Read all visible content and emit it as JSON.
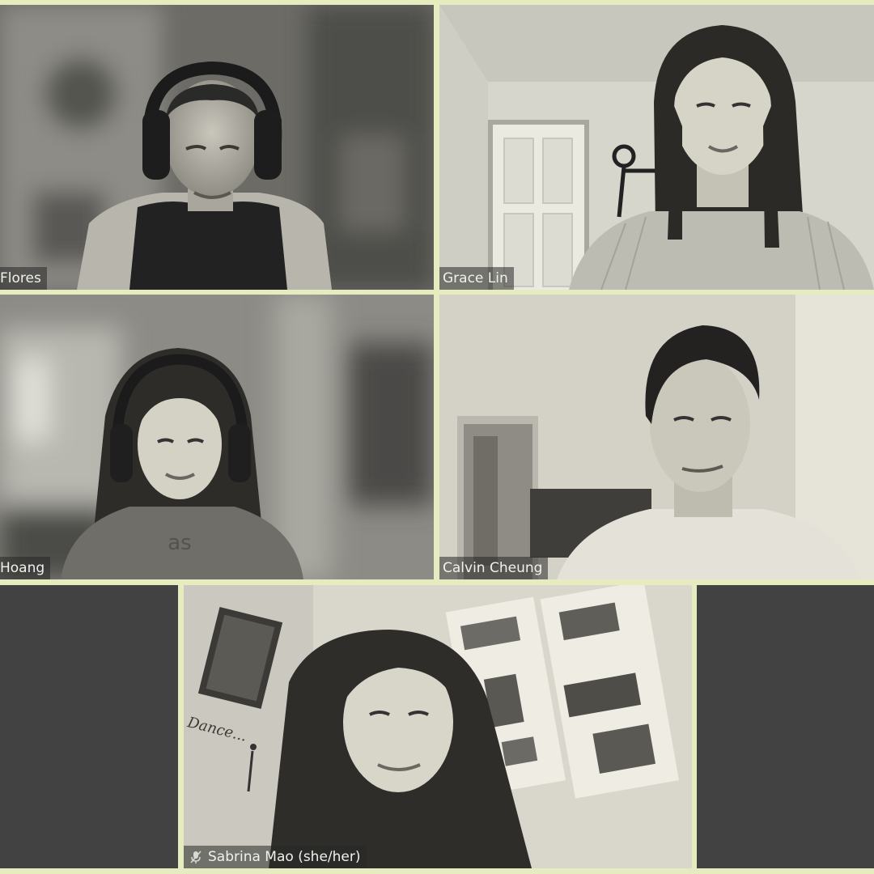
{
  "participants": [
    {
      "name": "Flores",
      "muted": false
    },
    {
      "name": "Grace Lin",
      "muted": false
    },
    {
      "name": "Hoang",
      "muted": false
    },
    {
      "name": "Calvin Cheung",
      "muted": false
    },
    {
      "name": "Sabrina Mao (she/her)",
      "muted": true
    }
  ],
  "wall_text": "Dance...",
  "colors": {
    "border": "#e6ecbf",
    "empty_tile": "#424242",
    "label_bg": "#282828",
    "label_text": "#f1f1ea"
  }
}
